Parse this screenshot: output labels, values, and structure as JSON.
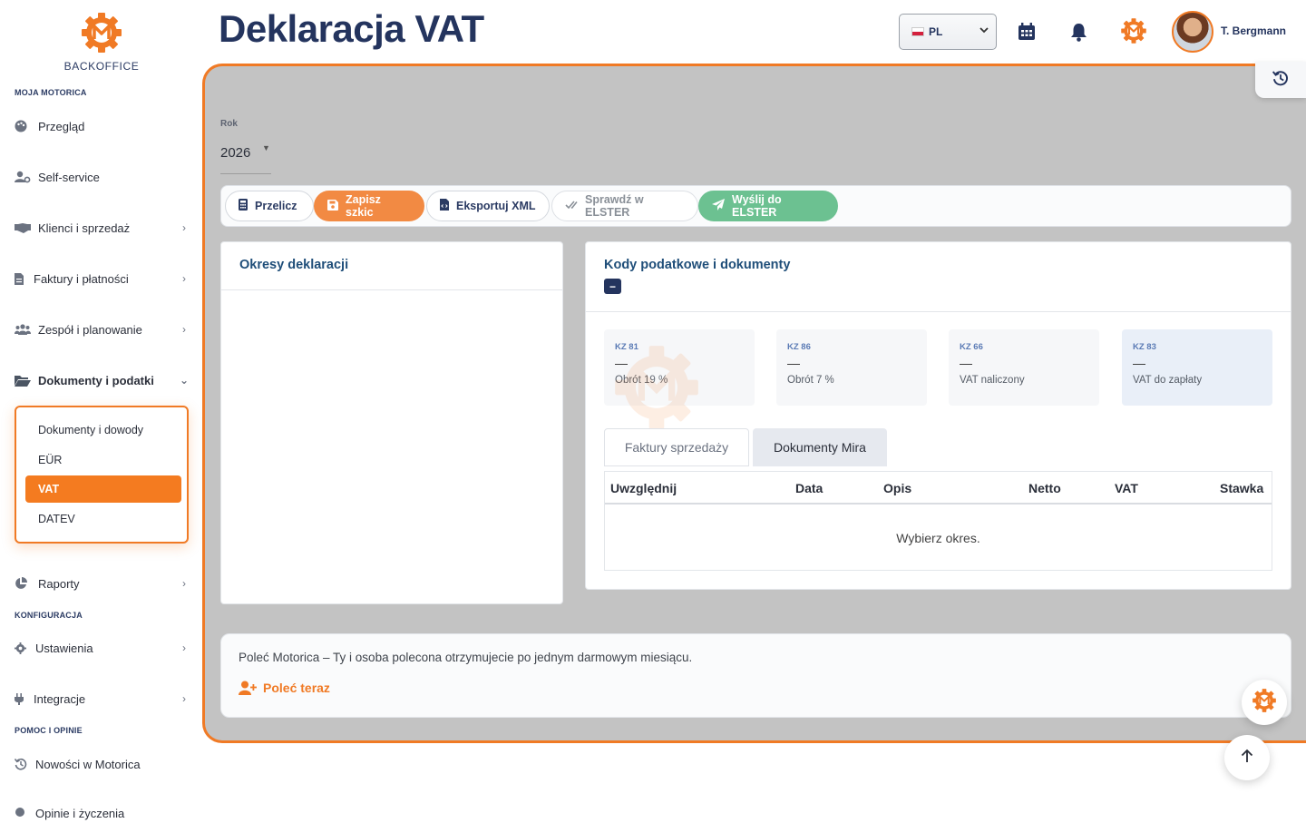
{
  "sidebar": {
    "brand_label": "BACKOFFICE",
    "sections": {
      "moja": "MOJA MOTORICA",
      "konfig": "KONFIGURACJA",
      "pomoc": "POMOC I OPINIE"
    },
    "items": {
      "przeglad": "Przegląd",
      "self_service": "Self-service",
      "klienci": "Klienci i sprzedaż",
      "faktury": "Faktury i płatności",
      "zespol": "Zespół i planowanie",
      "dokumenty": "Dokumenty i podatki",
      "raporty": "Raporty",
      "ustawienia": "Ustawienia",
      "integracje": "Integracje",
      "nowosci": "Nowości w Motorica",
      "opinie": "Opinie i życzenia"
    },
    "subitems": {
      "dowody": "Dokumenty i dowody",
      "eur": "EÜR",
      "vat": "VAT",
      "datev": "DATEV"
    }
  },
  "header": {
    "title": "Deklaracja VAT",
    "language": "PL",
    "user_name": "T. Bergmann"
  },
  "filters": {
    "year_label": "Rok",
    "year_value": "2026"
  },
  "toolbar": {
    "przelicz": "Przelicz",
    "zapisz": "Zapisz szkic",
    "eksportuj": "Eksportuj XML",
    "sprawdz": "Sprawdź w ELSTER",
    "wyslij": "Wyślij do ELSTER"
  },
  "periods": {
    "title": "Okresy deklaracji"
  },
  "codes": {
    "title": "Kody podatkowe i dokumenty",
    "collapse_symbol": "−",
    "kz": [
      {
        "code": "KZ 81",
        "value": "—",
        "desc": "Obrót 19 %"
      },
      {
        "code": "KZ 86",
        "value": "—",
        "desc": "Obrót 7 %"
      },
      {
        "code": "KZ 66",
        "value": "—",
        "desc": "VAT naliczony"
      },
      {
        "code": "KZ 83",
        "value": "—",
        "desc": "VAT do zapłaty"
      }
    ],
    "tabs": {
      "faktury": "Faktury sprzedaży",
      "mira": "Dokumenty Mira"
    },
    "table": {
      "columns": [
        "Uwzględnij",
        "Data",
        "Opis",
        "Netto",
        "VAT",
        "Stawka"
      ],
      "empty": "Wybierz okres."
    }
  },
  "referral": {
    "text": "Poleć Motorica – Ty i osoba polecona otrzymujecie po jednym darmowym miesiącu.",
    "link": "Poleć teraz"
  },
  "colors": {
    "accent": "#f07a25",
    "brand_navy": "#24345e",
    "success": "#6cc191"
  }
}
